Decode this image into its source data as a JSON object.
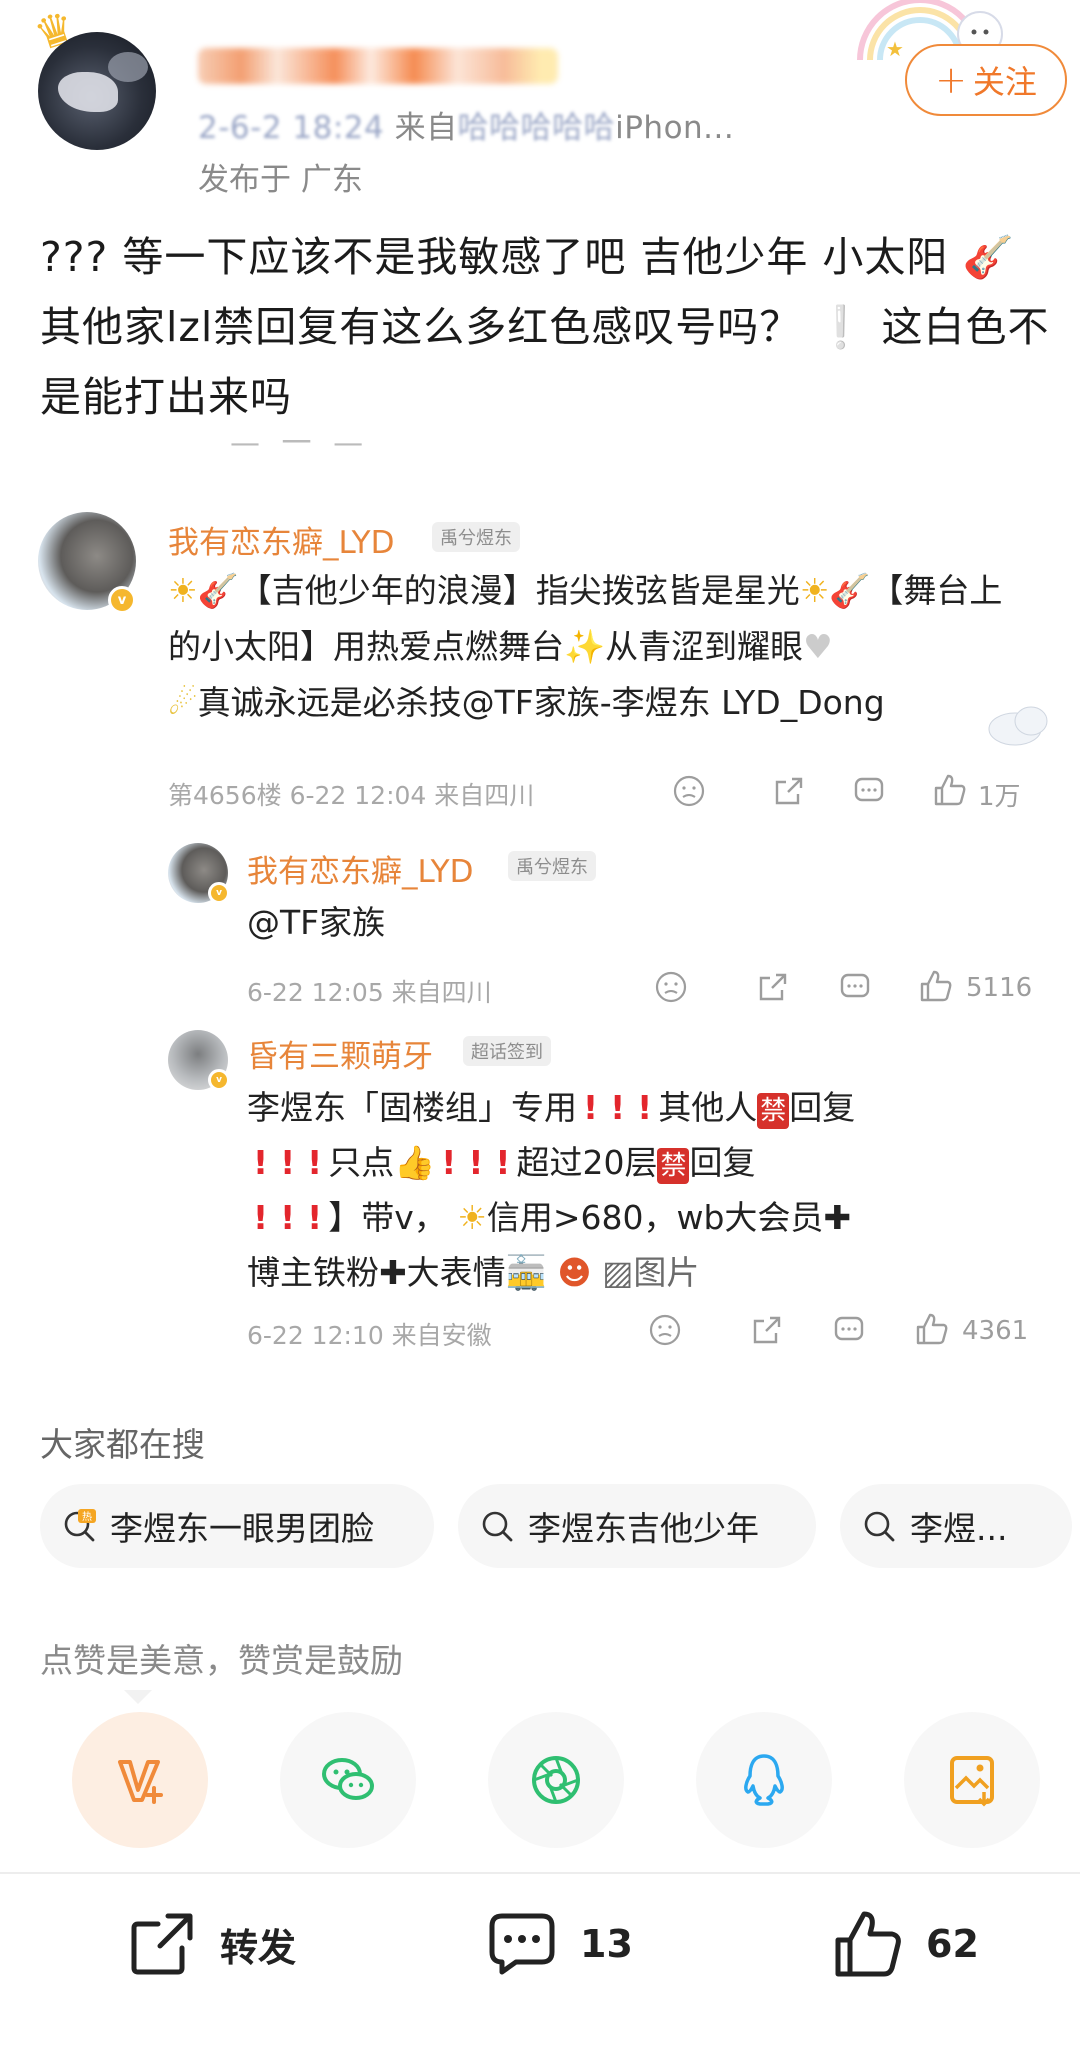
{
  "header": {
    "meta_line_blurred_prefix": "2-6-2",
    "meta_line_blurred_time": "18:24",
    "meta_line_source_prefix": "来自",
    "meta_line_source_blurred": "哈哈哈哈哈",
    "meta_line_source_device": "iPhon...",
    "location": "发布于 广东",
    "follow_label": "关注"
  },
  "post": {
    "text_before_guitar": "??? 等一下应该不是我敏感了吧 吉他少年 小太阳",
    "guitar_emoji": "🎸",
    "text_after_guitar": " 其他家lzl禁回复有这么多红色感叹号吗？ ",
    "white_mark": "❕",
    "text_end": "这白色不是能打出来吗"
  },
  "screenshot": {
    "comment1": {
      "name": "我有恋东癖_LYD",
      "tag": "禹兮煜东",
      "part1": "【吉他少年的浪漫】指尖拨弦皆是星光",
      "part2": "【舞台上的小太阳】用热爱点燃舞台",
      "part3": "从青涩到耀眼",
      "part4": "真诚永远是必杀技@TF家族-李煜东 LYD_Dong",
      "meta": "第4656楼 6-22 12:04 来自四川",
      "likes": "1万"
    },
    "comment2": {
      "name": "我有恋东癖_LYD",
      "tag": "禹兮煜东",
      "text": "@TF家族",
      "meta": "6-22 12:05 来自四川",
      "likes": "5116"
    },
    "comment3": {
      "name": "昏有三颗萌牙",
      "tag": "超话签到",
      "l1a": "李煜东「固楼组」专用",
      "l1b": "其他人",
      "ban_char": "禁",
      "l1c": "回复",
      "l2a": "只点",
      "l2b": "超过20层",
      "l2c": "回复",
      "l3a": "】带v，",
      "l3b": "信用>680，wb大会员",
      "l4a": "博主铁粉",
      "l4b": "大表情",
      "l4c": "图片",
      "meta": "6-22 12:10 来自安徽",
      "likes": "4361"
    }
  },
  "hot_search": {
    "title": "大家都在搜",
    "hot_mark": "热",
    "chips": [
      "李煜东一眼男团脸",
      "李煜东吉他少年",
      "李煜..."
    ]
  },
  "reward": {
    "title": "点赞是美意，赞赏是鼓励",
    "icons": [
      "v-plus-icon",
      "wechat-icon",
      "moments-icon",
      "qq-icon",
      "save-image-icon"
    ]
  },
  "bottom_bar": {
    "repost_label": "转发",
    "comment_count": "13",
    "like_count": "62"
  },
  "colors": {
    "accent_orange": "#f0782a",
    "name_orange": "#e7853a",
    "bang_red": "#e3262d"
  }
}
